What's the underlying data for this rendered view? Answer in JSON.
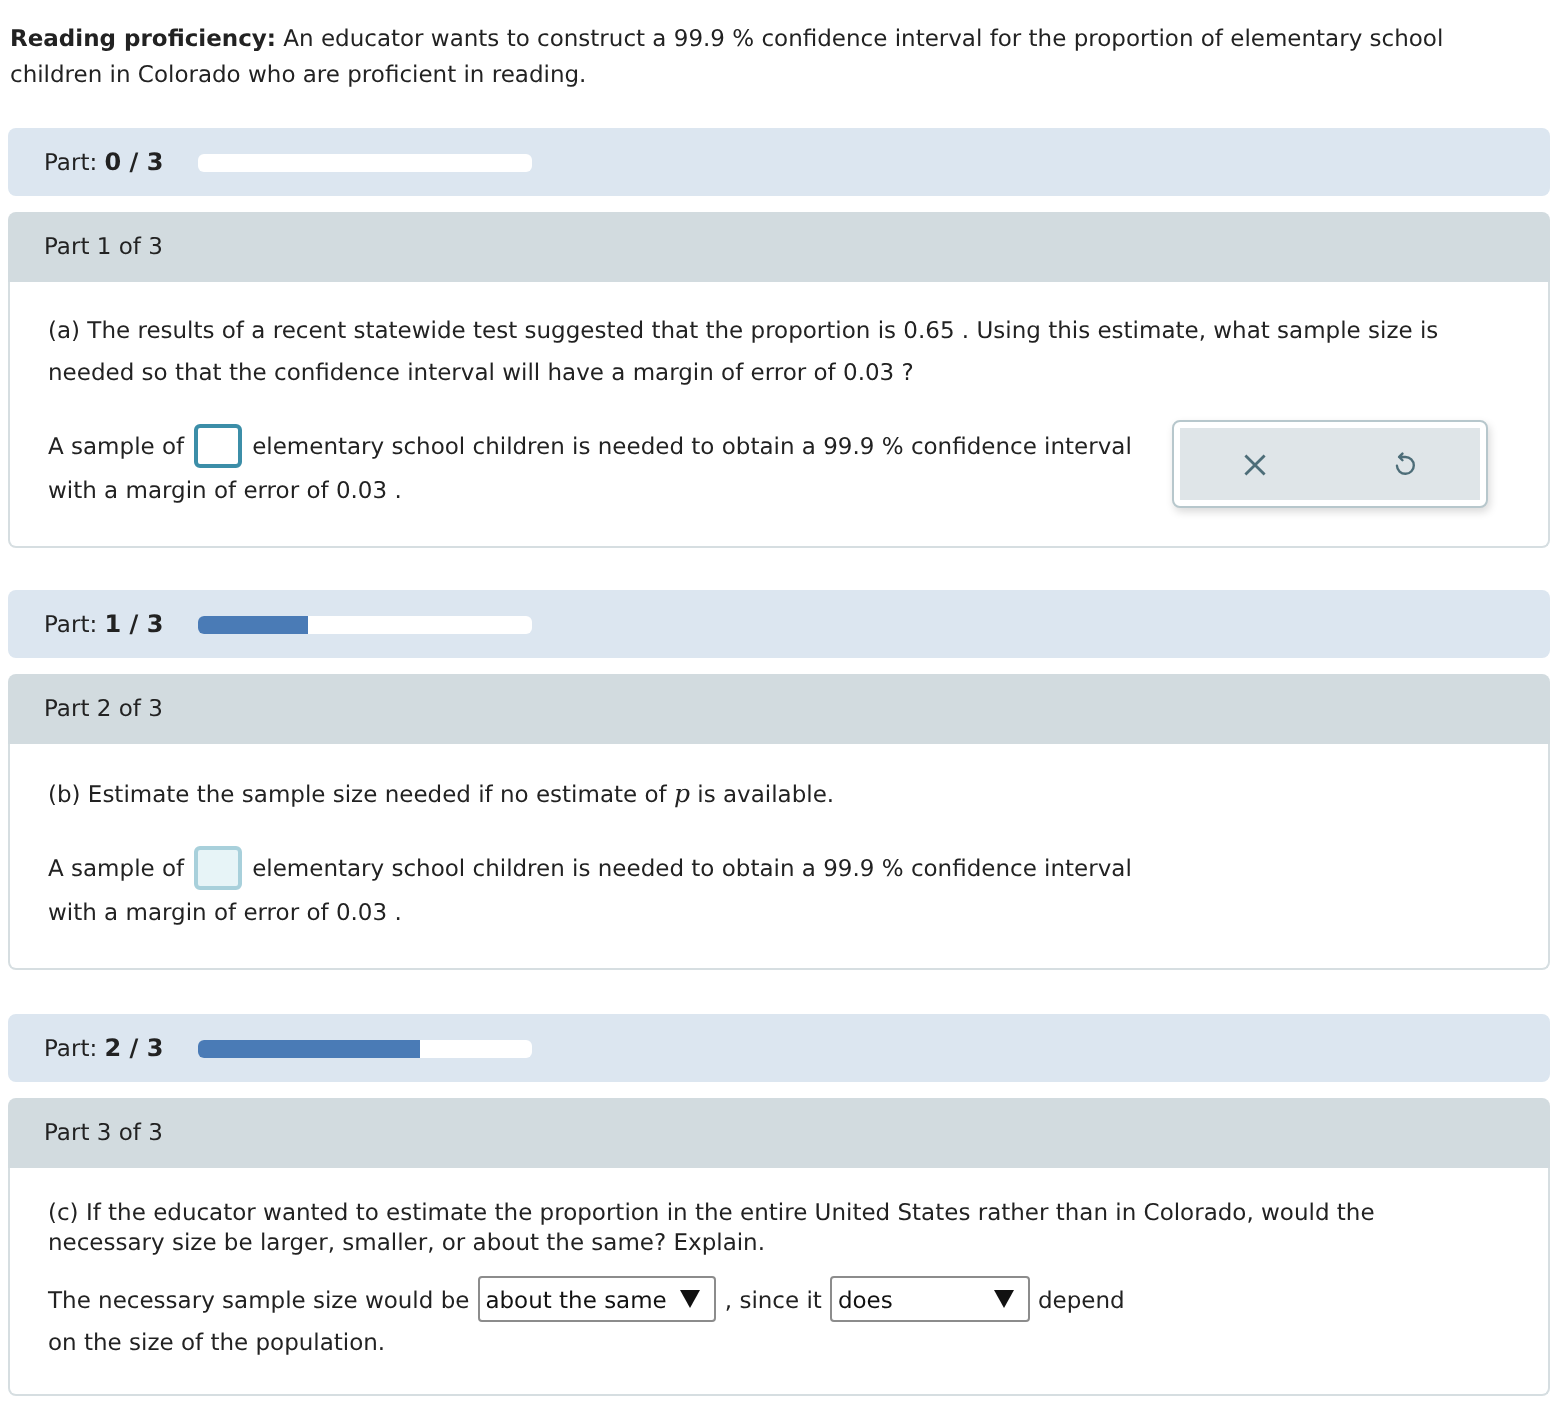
{
  "intro": "**Reading proficiency:** An educator wants to construct a 99.9 % confidence interval for the proportion of elementary school children in Colorado who are proficient in reading.",
  "parts": [
    {
      "progress": {
        "text": "Part: **0 / 3**",
        "level": 0
      },
      "header": "Part 1 of 3",
      "question": "(a) The results of a recent statewide test suggested that the proportion is 0.65 . Using this estimate, what sample size is needed so that the confidence interval will have a margin of error of 0.03 ?",
      "answer_lines": [
        [
          {
            "kind": "text",
            "text": "A sample of"
          },
          {
            "kind": "input",
            "focused": true
          },
          {
            "kind": "text",
            "text": "elementary school children is needed to obtain a 99.9 % confidence interval"
          }
        ],
        [
          {
            "kind": "text",
            "text": "with a margin of error of 0.03 ."
          }
        ]
      ],
      "tools_panel": true
    },
    {
      "progress": {
        "text": "Part: **1 / 3**",
        "level": 0.333
      },
      "header": "Part 2 of 3",
      "question": "(b) Estimate the sample size needed if no estimate of *p* is available.",
      "answer_lines": [
        [
          {
            "kind": "text",
            "text": "A sample of"
          },
          {
            "kind": "input",
            "focused": false
          },
          {
            "kind": "text",
            "text": "elementary school children is needed to obtain a 99.9 % confidence interval"
          }
        ],
        [
          {
            "kind": "text",
            "text": "with a margin of error of 0.03 ."
          }
        ]
      ],
      "tools_panel": false
    },
    {
      "progress": {
        "text": "Part: **2 / 3**",
        "level": 0.667
      },
      "header": "Part 3 of 3",
      "question": "(c) If the educator wanted to estimate the proportion in the entire United States rather than in Colorado, would the necessary size be larger, smaller, or about the same? Explain.",
      "answer_lines": [
        [
          {
            "kind": "text",
            "text": "The necessary sample size would be"
          },
          {
            "kind": "select",
            "value": "about the same"
          },
          {
            "kind": "text",
            "text": ", since it"
          },
          {
            "kind": "select",
            "value": "does"
          },
          {
            "kind": "text",
            "text": "depend"
          }
        ],
        [
          {
            "kind": "text",
            "text": "on the size of the population."
          }
        ]
      ],
      "tools_panel": false
    }
  ]
}
